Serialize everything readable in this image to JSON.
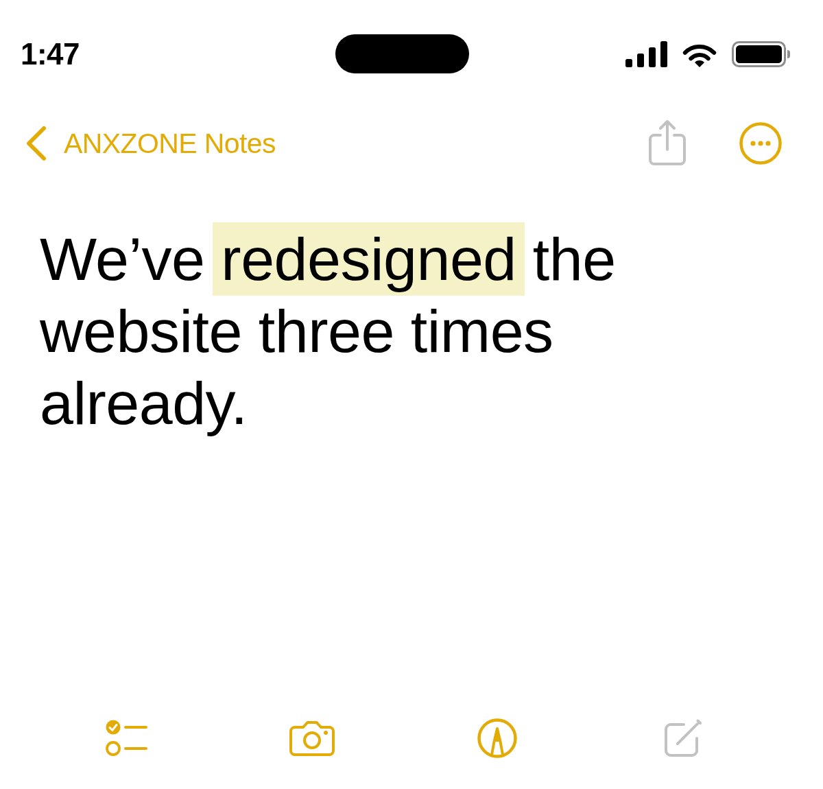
{
  "status_bar": {
    "time": "1:47"
  },
  "nav_bar": {
    "back_label": "ANXZONE Notes",
    "actions": [
      {
        "kind": "share",
        "disabled": true
      },
      {
        "kind": "more",
        "disabled": false
      }
    ]
  },
  "note": {
    "segments": [
      {
        "text": "We’ve ",
        "highlighted": false
      },
      {
        "text": "redesigned",
        "highlighted": true
      },
      {
        "text": " the website three times already.",
        "highlighted": false
      }
    ]
  },
  "toolbar": {
    "buttons": [
      {
        "kind": "checklist",
        "disabled": false
      },
      {
        "kind": "camera",
        "disabled": false
      },
      {
        "kind": "markup",
        "disabled": false
      },
      {
        "kind": "compose",
        "disabled": true
      }
    ]
  }
}
